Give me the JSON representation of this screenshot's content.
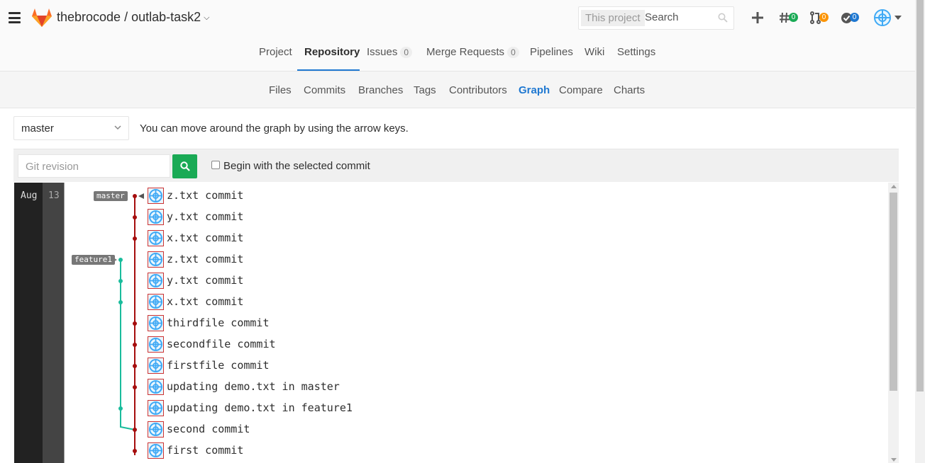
{
  "header": {
    "project_path": "thebrocode / outlab-task2",
    "search": {
      "scope": "This project",
      "placeholder": "Search"
    },
    "badges": {
      "issues": "0",
      "merge_requests": "0",
      "todos": "0"
    },
    "colors": {
      "issues_badge": "#1aaa55",
      "mr_badge": "#fc9403",
      "todos_badge": "#1f78d1"
    }
  },
  "nav": {
    "tabs": [
      {
        "label": "Project"
      },
      {
        "label": "Repository"
      },
      {
        "label": "Issues",
        "count": "0"
      },
      {
        "label": "Merge Requests",
        "count": "0"
      },
      {
        "label": "Pipelines"
      },
      {
        "label": "Wiki"
      },
      {
        "label": "Settings"
      }
    ],
    "active": "Repository"
  },
  "subnav": {
    "tabs": [
      "Files",
      "Commits",
      "Branches",
      "Tags",
      "Contributors",
      "Graph",
      "Compare",
      "Charts"
    ],
    "active": "Graph"
  },
  "branch_select": {
    "value": "master"
  },
  "hint": "You can move around the graph by using the arrow keys.",
  "filter": {
    "placeholder": "Git revision",
    "checkbox_label": "Begin with the selected commit"
  },
  "graph": {
    "month": "Aug",
    "day": "13",
    "refs": [
      {
        "label": "master"
      },
      {
        "label": "feature1"
      }
    ],
    "commits": [
      {
        "message": "z.txt commit",
        "branch": "master"
      },
      {
        "message": "y.txt commit",
        "branch": "master"
      },
      {
        "message": "x.txt commit",
        "branch": "master"
      },
      {
        "message": "z.txt commit",
        "branch": "feature1"
      },
      {
        "message": "y.txt commit",
        "branch": "feature1"
      },
      {
        "message": "x.txt commit",
        "branch": "feature1"
      },
      {
        "message": "thirdfile commit",
        "branch": "master"
      },
      {
        "message": "secondfile commit",
        "branch": "master"
      },
      {
        "message": "firstfile commit",
        "branch": "master"
      },
      {
        "message": "updating demo.txt in master",
        "branch": "master"
      },
      {
        "message": "updating demo.txt in feature1",
        "branch": "feature1"
      },
      {
        "message": "second commit",
        "branch": "master"
      },
      {
        "message": "first commit",
        "branch": "master"
      }
    ],
    "colors": {
      "master": "#a50d0d",
      "feature1": "#1abc9c"
    }
  }
}
